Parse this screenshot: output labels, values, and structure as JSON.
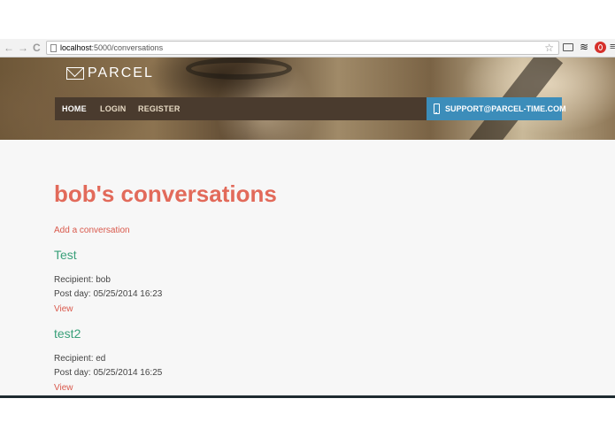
{
  "browser": {
    "back": "←",
    "forward": "→",
    "reload": "C",
    "url_host": "localhost",
    "url_rest": ":5000/conversations",
    "star": "☆",
    "layers": "≋",
    "menu": "≡"
  },
  "site": {
    "logo_text": "PARCEL",
    "nav": [
      {
        "label": "HOME",
        "active": true
      },
      {
        "label": "LOGIN",
        "active": false
      },
      {
        "label": "REGISTER",
        "active": false
      }
    ],
    "support_label": "SUPPORT@PARCEL-TIME.COM"
  },
  "main": {
    "title": "bob's conversations",
    "add_link": "Add a conversation",
    "conversations": [
      {
        "title": "Test",
        "recipient": "Recipient: bob",
        "post_day": "Post day: 05/25/2014 16:23",
        "view": "View"
      },
      {
        "title": "test2",
        "recipient": "Recipient: ed",
        "post_day": "Post day: 05/25/2014 16:25",
        "view": "View"
      }
    ]
  },
  "colors": {
    "title": "#e26a5a",
    "link": "#d9594c",
    "conversation_title": "#3aa07a",
    "navbar": "#4a3b2e",
    "support": "#3c8dba"
  }
}
